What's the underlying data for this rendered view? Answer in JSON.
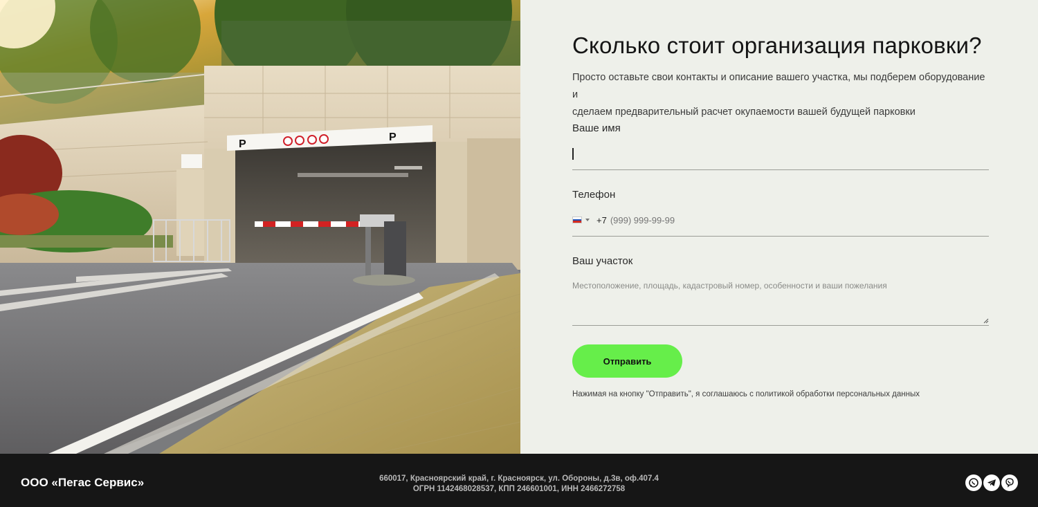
{
  "form": {
    "title": "Сколько стоит организация парковки?",
    "subtitle_line1": "Просто оставьте свои контакты и описание вашего участка, мы подберем оборудование и",
    "subtitle_line2": "сделаем предварительный расчет окупаемости вашей будущей парковки",
    "name_label": "Ваше имя",
    "name_value": "",
    "phone_label": "Телефон",
    "phone_country_icon": "russia-flag-icon",
    "phone_code": "+7",
    "phone_placeholder": "(999) 999-99-99",
    "plot_label": "Ваш участок",
    "plot_placeholder": "Местоположение, площадь, кадастровый номер, особенности и ваши пожелания",
    "submit_label": "Отправить",
    "consent_text": "Нажимая на кнопку \"Отправить\", я соглашаюсь с политикой обработки персональных данных"
  },
  "photo": {
    "signs": [
      "P",
      "P"
    ]
  },
  "footer": {
    "company": "ООО «Пегас Сервис»",
    "address_line1": "660017, Красноярский край, г. Красноярск, ул. Обороны, д.3в, оф.407.4",
    "address_line2": "ОГРН 1142468028537, КПП 246601001, ИНН 2466272758",
    "social_icons": [
      "whatsapp-icon",
      "telegram-icon",
      "viber-icon"
    ]
  },
  "colors": {
    "accent": "#66ee4a",
    "panel_bg": "#eef0ea",
    "footer_bg": "#161616"
  }
}
